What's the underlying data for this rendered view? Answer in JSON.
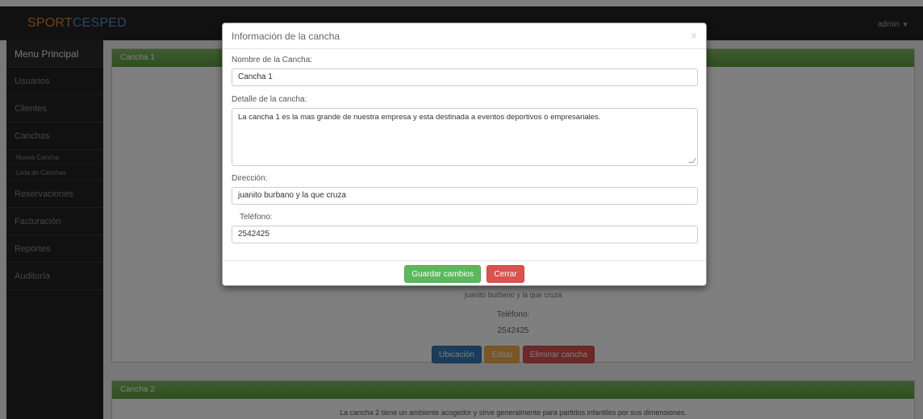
{
  "brand": {
    "part1": "SPORT",
    "part2": "CESPED"
  },
  "navbar": {
    "user": "admin"
  },
  "sidebar": {
    "items": [
      {
        "label": "Menu Principal"
      },
      {
        "label": "Usuarios"
      },
      {
        "label": "Clientes"
      },
      {
        "label": "Canchas"
      }
    ],
    "subitems": [
      {
        "label": "Nueva Cancha"
      },
      {
        "label": "Lista de Canchas"
      }
    ],
    "items_after": [
      {
        "label": "Reservaciones"
      },
      {
        "label": "Facturación"
      },
      {
        "label": "Reportes"
      },
      {
        "label": "Auditoría"
      }
    ]
  },
  "panel1": {
    "title": "Cancha 1",
    "address": "juanito burbano y la que cruza",
    "phone_label": "Teléfono:",
    "phone": "2542425",
    "buttons": {
      "location": "Ubicación",
      "edit": "Editar",
      "delete": "Eliminar cancha"
    }
  },
  "panel2": {
    "title": "Cancha 2",
    "description": "La cancha 2 tiene un ambiente acogedor y sirve generalmente para partidos infantiles por sus dimensiones."
  },
  "modal": {
    "title": "Información de la cancha",
    "close_symbol": "×",
    "name_label": "Nombre de la Cancha:",
    "name_value": "Cancha 1",
    "detail_label": "Detalle de la cancha:",
    "detail_value": "La cancha 1 es la mas grande de nuestra empresa y esta destinada a eventos deportivos o empresariales.",
    "address_label": "Dirección:",
    "address_value": "juanito burbano y la que cruza",
    "phone_label": "Teléfono:",
    "phone_value": "2542425",
    "save_label": "Guardar cambios",
    "close_label": "Cerrar"
  },
  "colors": {
    "navbar": "#222222",
    "panel_heading": "#6aa84f",
    "brand_orange": "#ef7d2e",
    "brand_blue": "#5a8fc9",
    "primary": "#337ab7",
    "warning": "#f0ad4e",
    "danger": "#d9534f",
    "success": "#5cb85c"
  }
}
